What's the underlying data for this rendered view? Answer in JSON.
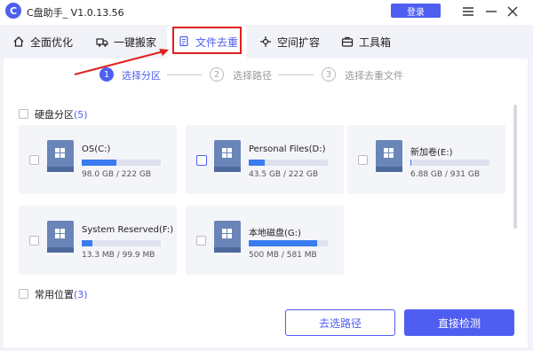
{
  "window": {
    "logo_char": "C",
    "title": "C盘助手_ V1.0.13.56",
    "login_label": "登录",
    "menu_icon": "menu-icon",
    "minimize_icon": "minimize-icon",
    "close_icon": "close-icon"
  },
  "tabs": [
    {
      "label": "全面优化",
      "icon": "home-icon"
    },
    {
      "label": "一键搬家",
      "icon": "truck-icon"
    },
    {
      "label": "文件去重",
      "icon": "copy-icon",
      "active": true
    },
    {
      "label": "空间扩容",
      "icon": "expand-icon"
    },
    {
      "label": "工具箱",
      "icon": "toolbox-icon"
    }
  ],
  "steps": [
    {
      "num": "1",
      "label": "选择分区",
      "active": true
    },
    {
      "num": "2",
      "label": "选择路径",
      "active": false
    },
    {
      "num": "3",
      "label": "选择去重文件",
      "active": false
    }
  ],
  "partitions": {
    "label": "硬盘分区",
    "count": "(5)",
    "drives": [
      {
        "name": "OS(C:)",
        "size": "98.0 GB / 222 GB",
        "used_fraction": 0.44
      },
      {
        "name": "Personal Files(D:)",
        "size": "43.5 GB / 222 GB",
        "used_fraction": 0.2
      },
      {
        "name": "新加卷(E:)",
        "size": "6.88 GB / 931 GB",
        "used_fraction": 0.01
      },
      {
        "name": "System Reserved(F:)",
        "size": "13.3 MB / 99.9 MB",
        "used_fraction": 0.13
      },
      {
        "name": "本地磁盘(G:)",
        "size": "500 MB / 581 MB",
        "used_fraction": 0.86
      }
    ]
  },
  "common": {
    "label": "常用位置",
    "count": "(3)"
  },
  "buttons": {
    "select_path": "去选路径",
    "scan": "直接检测"
  },
  "colors": {
    "accent": "#4e5ef0",
    "bar_fill": "#3a7bf0",
    "highlight": "#e02020"
  }
}
